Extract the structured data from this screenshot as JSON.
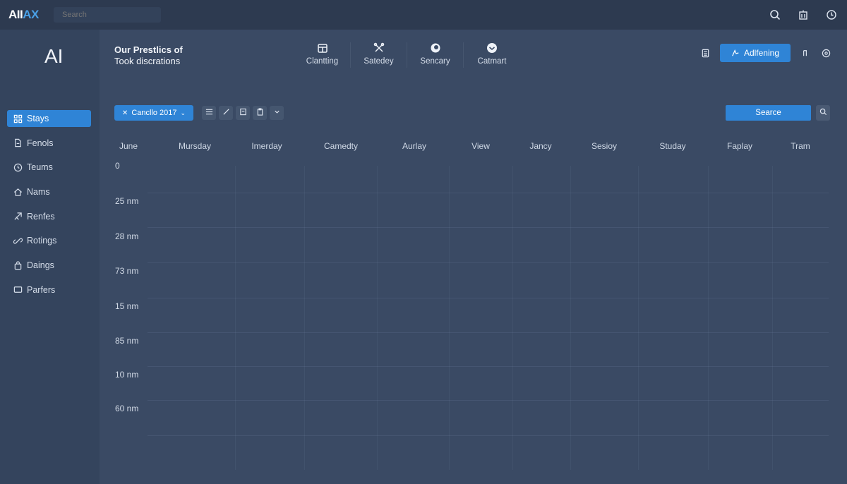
{
  "topbar": {
    "brand_part1": "AII",
    "brand_part2": "AX",
    "search_placeholder": "Search",
    "icons": [
      "search-icon",
      "building-icon",
      "clock-icon"
    ]
  },
  "sidebar": {
    "logo": "AI",
    "items": [
      {
        "label": "Stays",
        "icon": "grid-icon",
        "active": true
      },
      {
        "label": "Fenols",
        "icon": "document-icon",
        "active": false
      },
      {
        "label": "Teums",
        "icon": "clock-icon",
        "active": false
      },
      {
        "label": "Nams",
        "icon": "home-icon",
        "active": false
      },
      {
        "label": "Renfes",
        "icon": "arrow-icon",
        "active": false
      },
      {
        "label": "Rotings",
        "icon": "link-icon",
        "active": false
      },
      {
        "label": "Daings",
        "icon": "bag-icon",
        "active": false
      },
      {
        "label": "Parfers",
        "icon": "box-icon",
        "active": false
      }
    ]
  },
  "header": {
    "title_line1": "Our Prestlics of",
    "title_line2": "Took discrations",
    "tabs": [
      {
        "label": "Clantting",
        "icon": "calendar-icon"
      },
      {
        "label": "Satedey",
        "icon": "tools-icon"
      },
      {
        "label": "Sencary",
        "icon": "circle-icon"
      },
      {
        "label": "Catmart",
        "icon": "chat-icon"
      }
    ],
    "primary_button": "Adlfening",
    "right_icons": [
      "calculator-icon",
      "share-icon",
      "settings-icon"
    ]
  },
  "toolbar": {
    "date_select": "Cancllo 2017",
    "tool_icons": [
      "list-icon",
      "pencil-icon",
      "copy-icon",
      "clipboard-icon",
      "chevron-down-icon"
    ],
    "search_button": "Searce"
  },
  "columns": [
    "June",
    "Mursday",
    "Imerday",
    "Camedty",
    "Aurlay",
    "View",
    "Jancy",
    "Sesioy",
    "Studay",
    "Faplay",
    "Tram"
  ],
  "rows": [
    "0",
    "25 nm",
    "28 nm",
    "73 nm",
    "15 nm",
    "85 nm",
    "10 nm",
    "60 nm"
  ],
  "colors": {
    "accent": "#2f84d6",
    "background": "#3a4a64",
    "sidebar": "#34445d",
    "topbar": "#2d3a50"
  }
}
